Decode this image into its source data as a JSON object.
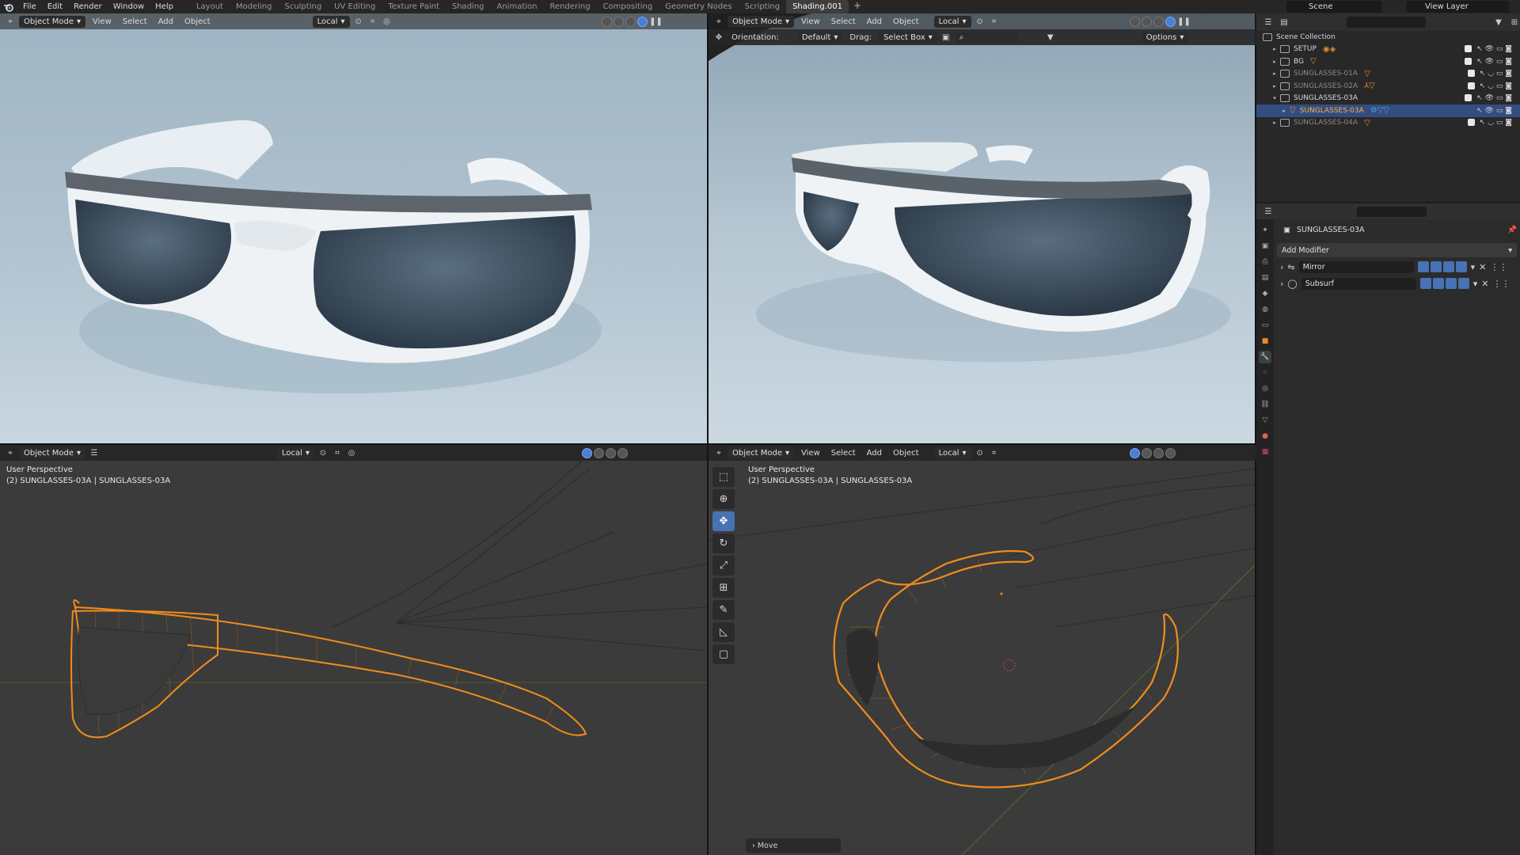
{
  "topbar": {
    "menu": [
      "File",
      "Edit",
      "Render",
      "Window",
      "Help"
    ],
    "workspaces": [
      "Layout",
      "Modeling",
      "Sculpting",
      "UV Editing",
      "Texture Paint",
      "Shading",
      "Animation",
      "Rendering",
      "Compositing",
      "Geometry Nodes",
      "Scripting",
      "Shading.001"
    ],
    "active_workspace": "Shading.001",
    "scene": "Scene",
    "view_layer": "View Layer"
  },
  "viewports": {
    "top_left": {
      "mode": "Object Mode",
      "menus": [
        "View",
        "Select",
        "Add",
        "Object"
      ],
      "transform": "Local"
    },
    "top_right": {
      "mode": "Object Mode",
      "menus": [
        "View",
        "Select",
        "Add",
        "Object"
      ],
      "transform": "Local",
      "orientation_label": "Orientation:",
      "orientation_value": "Default",
      "drag_label": "Drag:",
      "drag_value": "Select Box",
      "options": "Options"
    },
    "bottom_left": {
      "mode": "Object Mode",
      "transform": "Local",
      "perspective": "User Perspective",
      "object_info": "(2) SUNGLASSES-03A | SUNGLASSES-03A"
    },
    "bottom_right": {
      "mode": "Object Mode",
      "menus": [
        "View",
        "Select",
        "Add",
        "Object"
      ],
      "transform": "Local",
      "perspective": "User Perspective",
      "object_info": "(2) SUNGLASSES-03A | SUNGLASSES-03A",
      "last_op": "Move"
    }
  },
  "outliner": {
    "root": "Scene Collection",
    "items": [
      {
        "name": "SETUP",
        "state": "normal"
      },
      {
        "name": "BG",
        "state": "normal"
      },
      {
        "name": "SUNGLASSES-01A",
        "state": "dim"
      },
      {
        "name": "SUNGLASSES-02A",
        "state": "dim"
      },
      {
        "name": "SUNGLASSES-03A",
        "state": "normal"
      },
      {
        "name": "SUNGLASSES-03A",
        "state": "selected"
      },
      {
        "name": "SUNGLASSES-04A",
        "state": "dim"
      }
    ]
  },
  "properties": {
    "object_name": "SUNGLASSES-03A",
    "add_modifier": "Add Modifier",
    "modifiers": [
      "Mirror",
      "Subsurf"
    ]
  },
  "colors": {
    "wire": "#f28c1c",
    "accent": "#4772b3",
    "selected_row": "#334d80",
    "render_bg": "#a9bccb"
  }
}
